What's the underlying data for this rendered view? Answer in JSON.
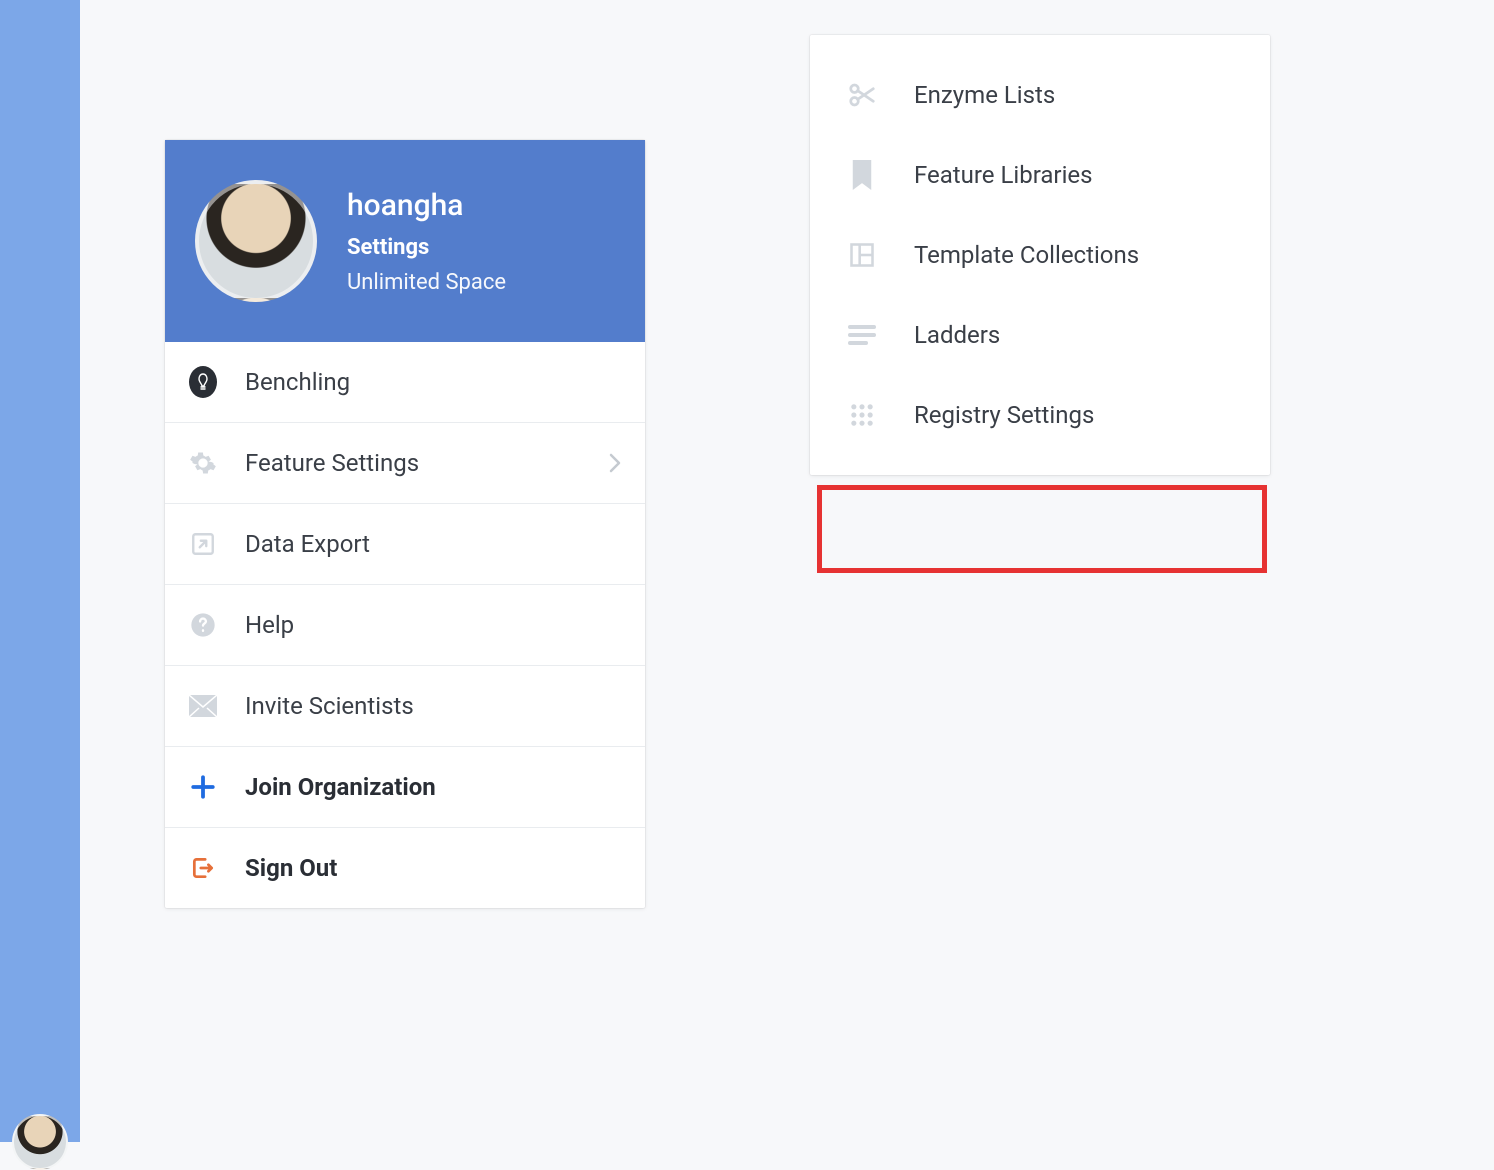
{
  "profile": {
    "username": "hoangha",
    "settings_label": "Settings",
    "space_label": "Unlimited Space"
  },
  "menu": {
    "items": [
      {
        "label": "Benchling",
        "icon": "benchling-icon",
        "bold": false,
        "chevron": false
      },
      {
        "label": "Feature Settings",
        "icon": "gear-icon",
        "bold": false,
        "chevron": true
      },
      {
        "label": "Data Export",
        "icon": "export-icon",
        "bold": false,
        "chevron": false
      },
      {
        "label": "Help",
        "icon": "help-icon",
        "bold": false,
        "chevron": false
      },
      {
        "label": "Invite Scientists",
        "icon": "mail-icon",
        "bold": false,
        "chevron": false
      },
      {
        "label": "Join Organization",
        "icon": "plus-icon",
        "bold": true,
        "chevron": false
      },
      {
        "label": "Sign Out",
        "icon": "signout-icon",
        "bold": true,
        "chevron": false
      }
    ]
  },
  "submenu": {
    "items": [
      {
        "label": "Enzyme Lists",
        "icon": "scissors-icon"
      },
      {
        "label": "Feature Libraries",
        "icon": "bookmark-icon"
      },
      {
        "label": "Template Collections",
        "icon": "template-icon"
      },
      {
        "label": "Ladders",
        "icon": "ladder-icon"
      },
      {
        "label": "Registry Settings",
        "icon": "grid-icon"
      }
    ]
  },
  "highlight": {
    "target": "Registry Settings"
  },
  "colors": {
    "rail": "#7ca7e8",
    "header": "#537dcc",
    "highlight": "#e63232",
    "icon_muted": "#d2d7dd",
    "text": "#3a3f47",
    "plus_blue": "#1f6be0",
    "signout_orange": "#e6703a"
  }
}
